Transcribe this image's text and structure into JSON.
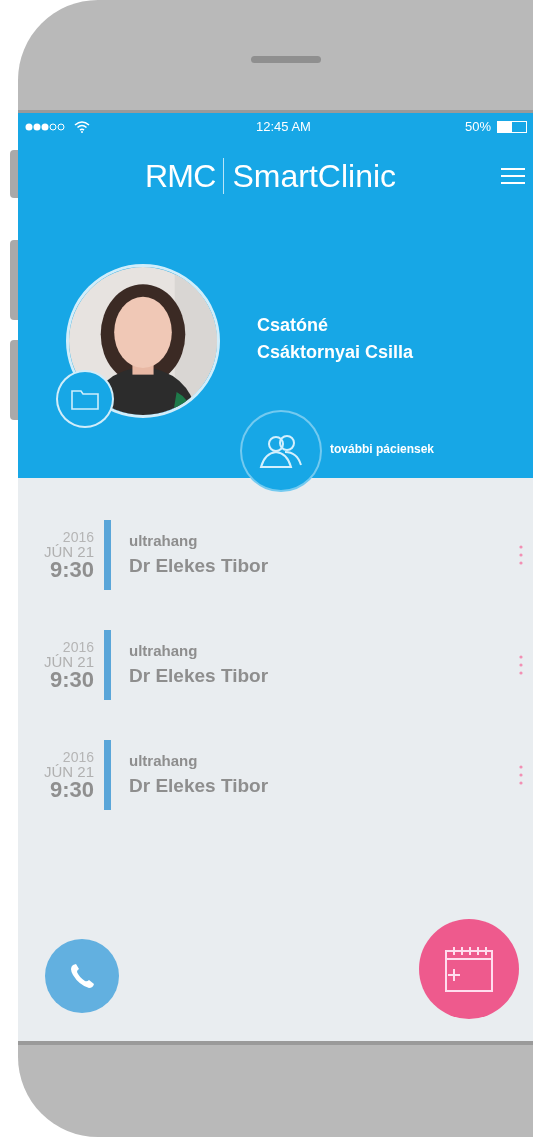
{
  "status_bar": {
    "time": "12:45 AM",
    "battery": "50%"
  },
  "header": {
    "logo_mark": "RMC",
    "logo_text": "SmartClinic"
  },
  "patient": {
    "name_lines": [
      "Csatóné",
      "Csáktornyai Csilla"
    ],
    "other_patients_label": "további páciensek"
  },
  "appointments": [
    {
      "year": "2016",
      "date": "JÚN 21",
      "time": "9:30",
      "type": "ultrahang",
      "doctor": "Dr Elekes Tibor"
    },
    {
      "year": "2016",
      "date": "JÚN 21",
      "time": "9:30",
      "type": "ultrahang",
      "doctor": "Dr Elekes Tibor"
    },
    {
      "year": "2016",
      "date": "JÚN 21",
      "time": "9:30",
      "type": "ultrahang",
      "doctor": "Dr Elekes Tibor"
    }
  ]
}
